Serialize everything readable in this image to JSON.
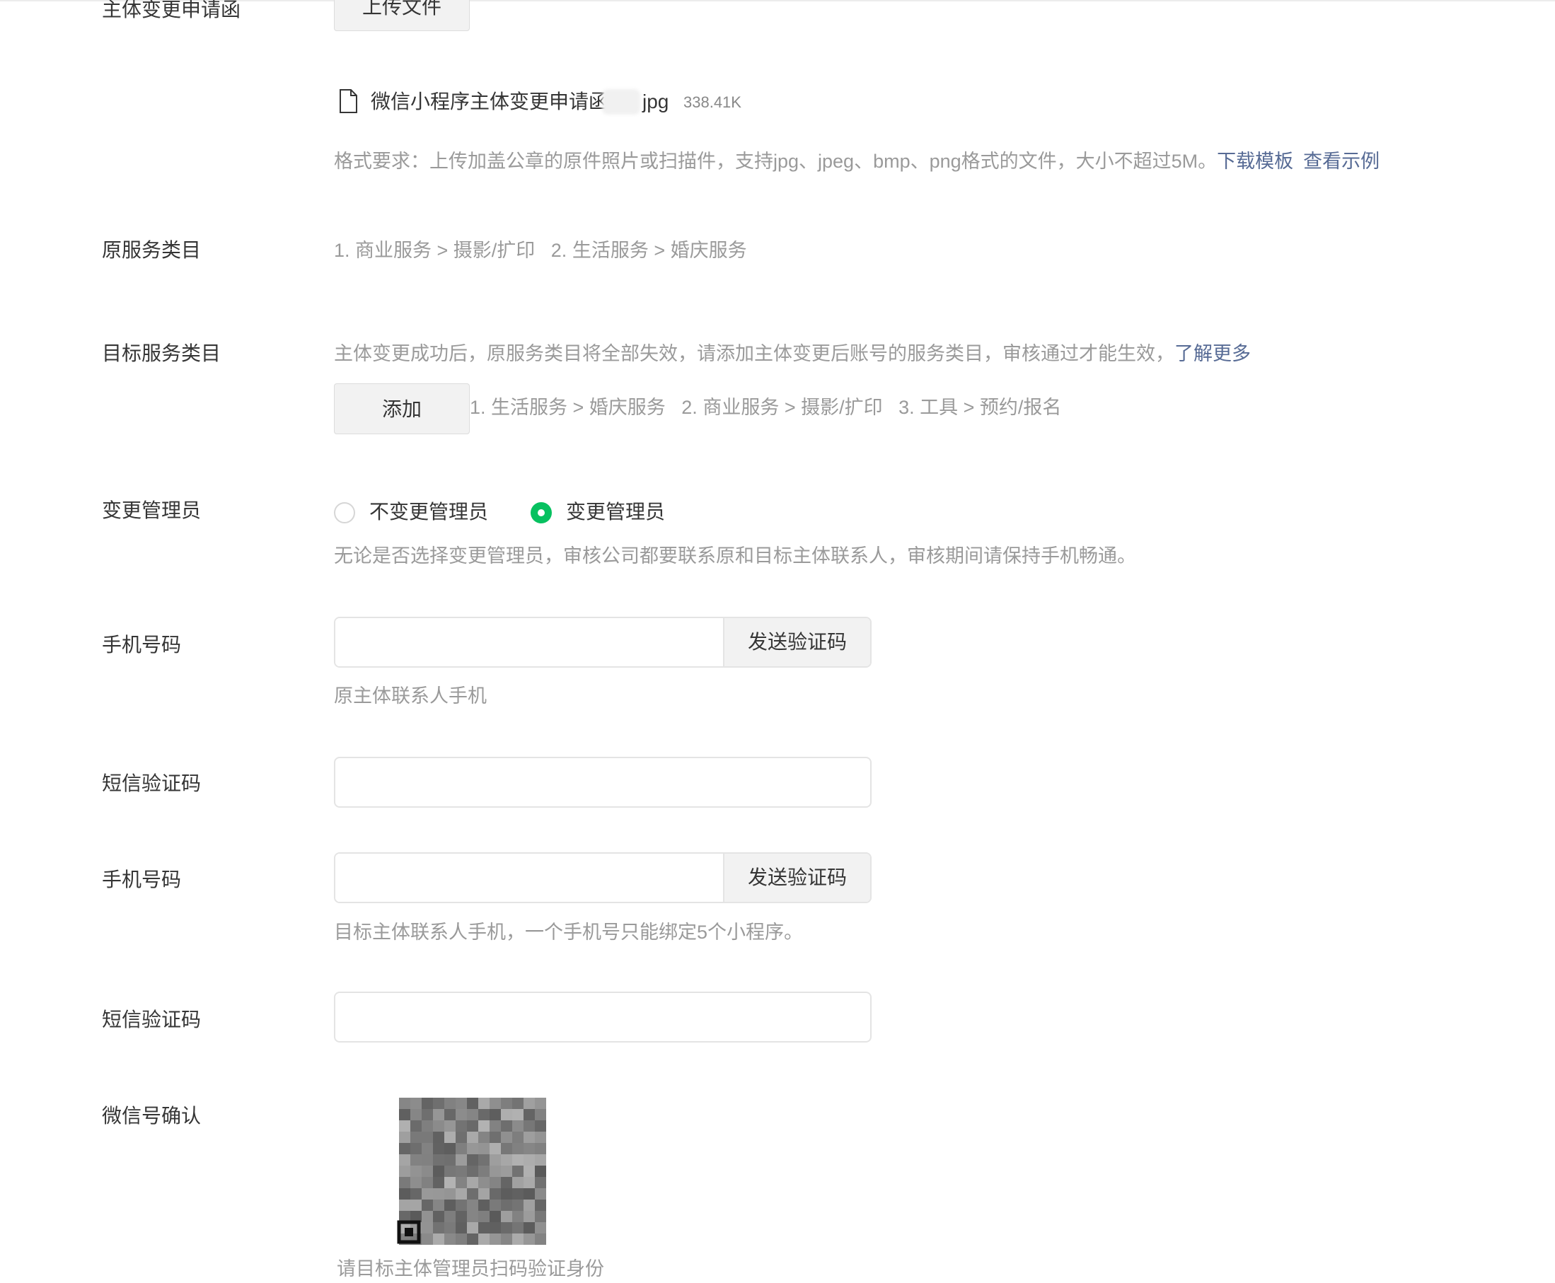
{
  "form": {
    "letter": {
      "label": "主体变更申请函",
      "upload_button": "上传文件",
      "file_name_prefix": "微信小程序主体变更申请函",
      "file_name_suffix": "jpg",
      "file_size": "338.41K",
      "format_tip": "格式要求：上传加盖公章的原件照片或扫描件，支持jpg、jpeg、bmp、png格式的文件，大小不超过5M。",
      "download_template_link": "下载模板",
      "view_example_link": "查看示例"
    },
    "original_category": {
      "label": "原服务类目",
      "value": "1. 商业服务 > 摄影/扩印   2. 生活服务 > 婚庆服务"
    },
    "target_category": {
      "label": "目标服务类目",
      "tip": "主体变更成功后，原服务类目将全部失效，请添加主体变更后账号的服务类目，审核通过才能生效，",
      "learn_more_link": "了解更多",
      "add_button": "添加",
      "value": "1. 生活服务 > 婚庆服务   2. 商业服务 > 摄影/扩印   3. 工具 > 预约/报名"
    },
    "admin_change": {
      "label": "变更管理员",
      "options": [
        "不变更管理员",
        "变更管理员"
      ],
      "selected_index": 1,
      "tip": "无论是否选择变更管理员，审核公司都要联系原和目标主体联系人，审核期间请保持手机畅通。"
    },
    "phone_original": {
      "label": "手机号码",
      "value": "",
      "send_button": "发送验证码",
      "tip": "原主体联系人手机"
    },
    "sms_original": {
      "label": "短信验证码",
      "value": ""
    },
    "phone_target": {
      "label": "手机号码",
      "value": "",
      "send_button": "发送验证码",
      "tip": "目标主体联系人手机，一个手机号只能绑定5个小程序。"
    },
    "sms_target": {
      "label": "短信验证码",
      "value": ""
    },
    "wechat_confirm": {
      "label": "微信号确认",
      "qr_icon": "qr-code-icon",
      "tip": "请目标主体管理员扫码验证身份"
    }
  },
  "colors": {
    "link": "#576b95",
    "radio_selected": "#07c160",
    "tip_text": "#9a9a9a"
  }
}
